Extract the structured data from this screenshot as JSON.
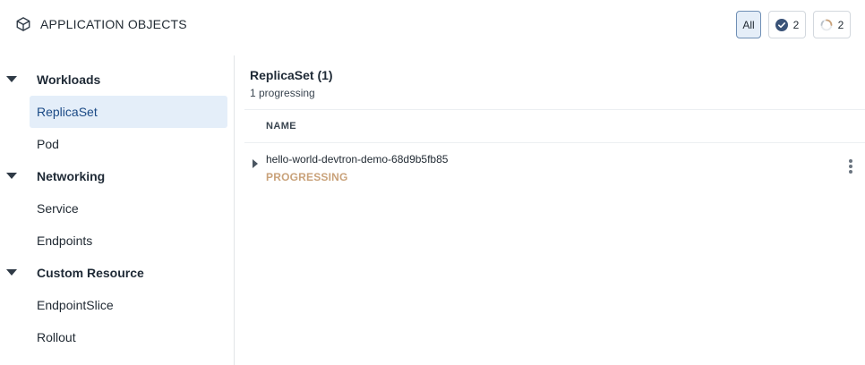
{
  "header": {
    "title": "APPLICATION OBJECTS",
    "icon": "cube-icon"
  },
  "filters": {
    "all_label": "All",
    "healthy_count": "2",
    "progressing_count": "2",
    "colors": {
      "active_bg": "#e5eef8",
      "healthy_icon": "#3a5378"
    }
  },
  "sidebar": {
    "groups": [
      {
        "label": "Workloads",
        "items": [
          "ReplicaSet",
          "Pod"
        ]
      },
      {
        "label": "Networking",
        "items": [
          "Service",
          "Endpoints"
        ]
      },
      {
        "label": "Custom Resource",
        "items": [
          "EndpointSlice",
          "Rollout"
        ]
      }
    ],
    "active_item": "ReplicaSet"
  },
  "main": {
    "title": "ReplicaSet (1)",
    "subtitle": "1 progressing",
    "column_header": "NAME",
    "rows": [
      {
        "name": "hello-world-devtron-demo-68d9b5fb85",
        "status": "PROGRESSING",
        "status_color": "#c9a27a"
      }
    ]
  }
}
